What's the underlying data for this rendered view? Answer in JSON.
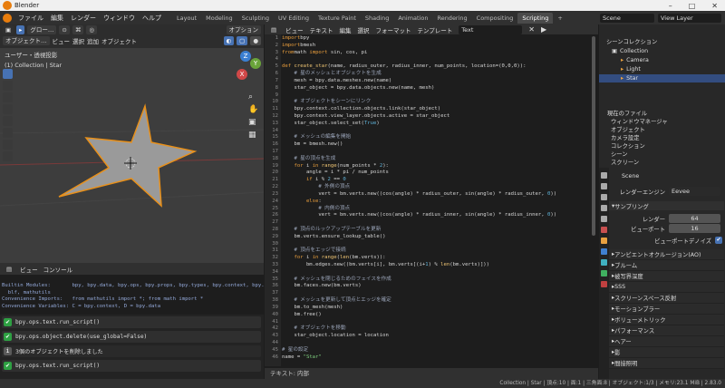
{
  "window": {
    "title": "Blender",
    "controls": [
      "–",
      "□",
      "✕"
    ]
  },
  "topbar": {
    "menus": [
      "ファイル",
      "編集",
      "レンダー",
      "ウィンドウ",
      "ヘルプ"
    ],
    "workspaces": [
      "Layout",
      "Modeling",
      "Sculpting",
      "UV Editing",
      "Texture Paint",
      "Shading",
      "Animation",
      "Rendering",
      "Compositing",
      "Scripting"
    ],
    "active_workspace": "Scripting",
    "plus": "+",
    "scene": "Scene",
    "view_layer": "View Layer"
  },
  "viewport": {
    "mode": "オブジェクト…",
    "menus": [
      "ビュー",
      "選択",
      "追加",
      "オブジェクト"
    ],
    "transform": "グロー…",
    "options": "オプション",
    "title": "ユーザー・透視投影",
    "subtitle": "(1) Collection | Star",
    "gizmo": {
      "z": "Z",
      "y": "Y",
      "x": "X"
    }
  },
  "console": {
    "menus": [
      "ビュー",
      "コンソール"
    ],
    "lines": [
      "Builtin Modules:       bpy, bpy.data, bpy.ops, bpy.props, bpy.types, bpy.context, bpy.utils, bgl,",
      "  blf, mathutils",
      "Convenience Imports:   from mathutils import *; from math import *",
      "Convenience Variables: C = bpy.context, D = bpy.data"
    ],
    "prompt": ">>> "
  },
  "info": {
    "rows": [
      {
        "type": "check",
        "text": "bpy.ops.text.run_script()"
      },
      {
        "type": "check",
        "text": "bpy.ops.object.delete(use_global=False)"
      },
      {
        "type": "info",
        "text": "3個のオブジェクトを削除しました"
      },
      {
        "type": "check",
        "text": "bpy.ops.text.run_script()"
      }
    ]
  },
  "editor": {
    "menus": [
      "ビュー",
      "テキスト",
      "編集",
      "選択",
      "フォーマット",
      "テンプレート"
    ],
    "text_name": "Text",
    "footer": "テキスト: 内部",
    "lines": [
      [
        [
          "k",
          "import"
        ],
        [
          "",
          "bpy"
        ]
      ],
      [
        [
          "k",
          "import"
        ],
        [
          "",
          "bmesh"
        ]
      ],
      [
        [
          "k",
          "from"
        ],
        [
          "",
          "math "
        ],
        [
          "k",
          "import"
        ],
        [
          "",
          " sin, cos, pi"
        ]
      ],
      [
        [
          "",
          ""
        ]
      ],
      [
        [
          "k",
          "def"
        ],
        [
          "f",
          " create_star"
        ],
        [
          "",
          "(name, radius_outer, radius_inner, num_points, location=(0,0,0)):"
        ]
      ],
      [
        [
          "c",
          "    # 星のメッシュとオブジェクトを生成"
        ]
      ],
      [
        [
          "",
          "    mesh = bpy.data.meshes.new(name)"
        ]
      ],
      [
        [
          "",
          "    star_object = bpy.data.objects.new(name, mesh)"
        ]
      ],
      [
        [
          "",
          ""
        ]
      ],
      [
        [
          "c",
          "    # オブジェクトをシーンにリンク"
        ]
      ],
      [
        [
          "",
          "    bpy.context.collection.objects.link(star_object)"
        ]
      ],
      [
        [
          "",
          "    bpy.context.view_layer.objects.active = star_object"
        ]
      ],
      [
        [
          "",
          "    star_object.select_set("
        ],
        [
          "n",
          "True"
        ],
        [
          "",
          ")"
        ]
      ],
      [
        [
          "",
          ""
        ]
      ],
      [
        [
          "c",
          "    # メッシュの編集を開始"
        ]
      ],
      [
        [
          "",
          "    bm = bmesh.new()"
        ]
      ],
      [
        [
          "",
          ""
        ]
      ],
      [
        [
          "c",
          "    # 星の頂点を生成"
        ]
      ],
      [
        [
          "k",
          "    for"
        ],
        [
          "",
          " i "
        ],
        [
          "k",
          "in"
        ],
        [
          "f",
          " range"
        ],
        [
          "",
          "(num_points * "
        ],
        [
          "n",
          "2"
        ],
        [
          "",
          "):"
        ]
      ],
      [
        [
          "",
          "        angle = i * pi / num_points"
        ]
      ],
      [
        [
          "k",
          "        if"
        ],
        [
          "",
          " i % "
        ],
        [
          "n",
          "2"
        ],
        [
          "",
          " == "
        ],
        [
          "n",
          "0"
        ],
        [
          ":"
        ]
      ],
      [
        [
          "c",
          "            # 外側の頂点"
        ]
      ],
      [
        [
          "",
          "            vert = bm.verts.new((cos(angle) * radius_outer, sin(angle) * radius_outer, "
        ],
        [
          "n",
          "0"
        ],
        [
          "",
          "))"
        ]
      ],
      [
        [
          "k",
          "        else"
        ],
        [
          "",
          ":"
        ]
      ],
      [
        [
          "c",
          "            # 内側の頂点"
        ]
      ],
      [
        [
          "",
          "            vert = bm.verts.new((cos(angle) * radius_inner, sin(angle) * radius_inner, "
        ],
        [
          "n",
          "0"
        ],
        [
          "",
          "))"
        ]
      ],
      [
        [
          "",
          ""
        ]
      ],
      [
        [
          "c",
          "    # 頂点のルックアップテーブルを更新"
        ]
      ],
      [
        [
          "",
          "    bm.verts.ensure_lookup_table()"
        ]
      ],
      [
        [
          "",
          ""
        ]
      ],
      [
        [
          "c",
          "    # 頂点をエッジで接続"
        ]
      ],
      [
        [
          "k",
          "    for"
        ],
        [
          "",
          " i "
        ],
        [
          "k",
          "in"
        ],
        [
          "f",
          " range"
        ],
        [
          "",
          "("
        ],
        [
          "f",
          "len"
        ],
        [
          "",
          "(bm.verts)):"
        ]
      ],
      [
        [
          "",
          "        bm.edges.new((bm.verts[i], bm.verts[(i+"
        ],
        [
          "n",
          "1"
        ],
        [
          "",
          ") % "
        ],
        [
          "f",
          "len"
        ],
        [
          "",
          "(bm.verts)]))"
        ]
      ],
      [
        [
          "",
          ""
        ]
      ],
      [
        [
          "c",
          "    # メッシュを閉じるためのフェイスを作成"
        ]
      ],
      [
        [
          "",
          "    bm.faces.new(bm.verts)"
        ]
      ],
      [
        [
          "",
          ""
        ]
      ],
      [
        [
          "c",
          "    # メッシュを更新して頂点とエッジを確定"
        ]
      ],
      [
        [
          "",
          "    bm.to_mesh(mesh)"
        ]
      ],
      [
        [
          "",
          "    bm.free()"
        ]
      ],
      [
        [
          "",
          ""
        ]
      ],
      [
        [
          "c",
          "    # オブジェクトを移動"
        ]
      ],
      [
        [
          "",
          "    star_object.location = location"
        ]
      ],
      [
        [
          "",
          ""
        ]
      ],
      [
        [
          "c",
          "# 星の設定"
        ]
      ],
      [
        [
          "",
          "name = "
        ],
        [
          "s",
          "\"Star\""
        ]
      ]
    ]
  },
  "outliner": {
    "title": "シーンコレクション",
    "items": [
      "Collection",
      "Camera",
      "Light",
      "Star"
    ],
    "selected": "Star"
  },
  "properties": {
    "filters": [
      "現在のファイル",
      "ウィンドウマネージャ",
      "オブジェクト",
      "カメラ設定",
      "コレクション",
      "シーン",
      "スクリーン"
    ],
    "scene": "Scene",
    "render_engine_label": "レンダーエンジン",
    "render_engine": "Eevee",
    "sampling": "サンプリング",
    "render_label": "レンダー",
    "render_value": "64",
    "viewport_label": "ビューポート",
    "viewport_value": "16",
    "denoise": "ビューポートデノイズ",
    "panels": [
      "アンビエントオクルージョン(AO)",
      "ブルーム",
      "被写界深度",
      "SSS",
      "スクリーンスペース反射",
      "モーションブラー",
      "ボリューメトリック",
      "パフォーマンス",
      "ヘアー",
      "影",
      "間接照明"
    ]
  },
  "status": "Collection | Star | 頂点:10 | 面:1 | 三角面:8 | オブジェクト:1/3 | メモリ:23.1 MiB | 2.83.0"
}
